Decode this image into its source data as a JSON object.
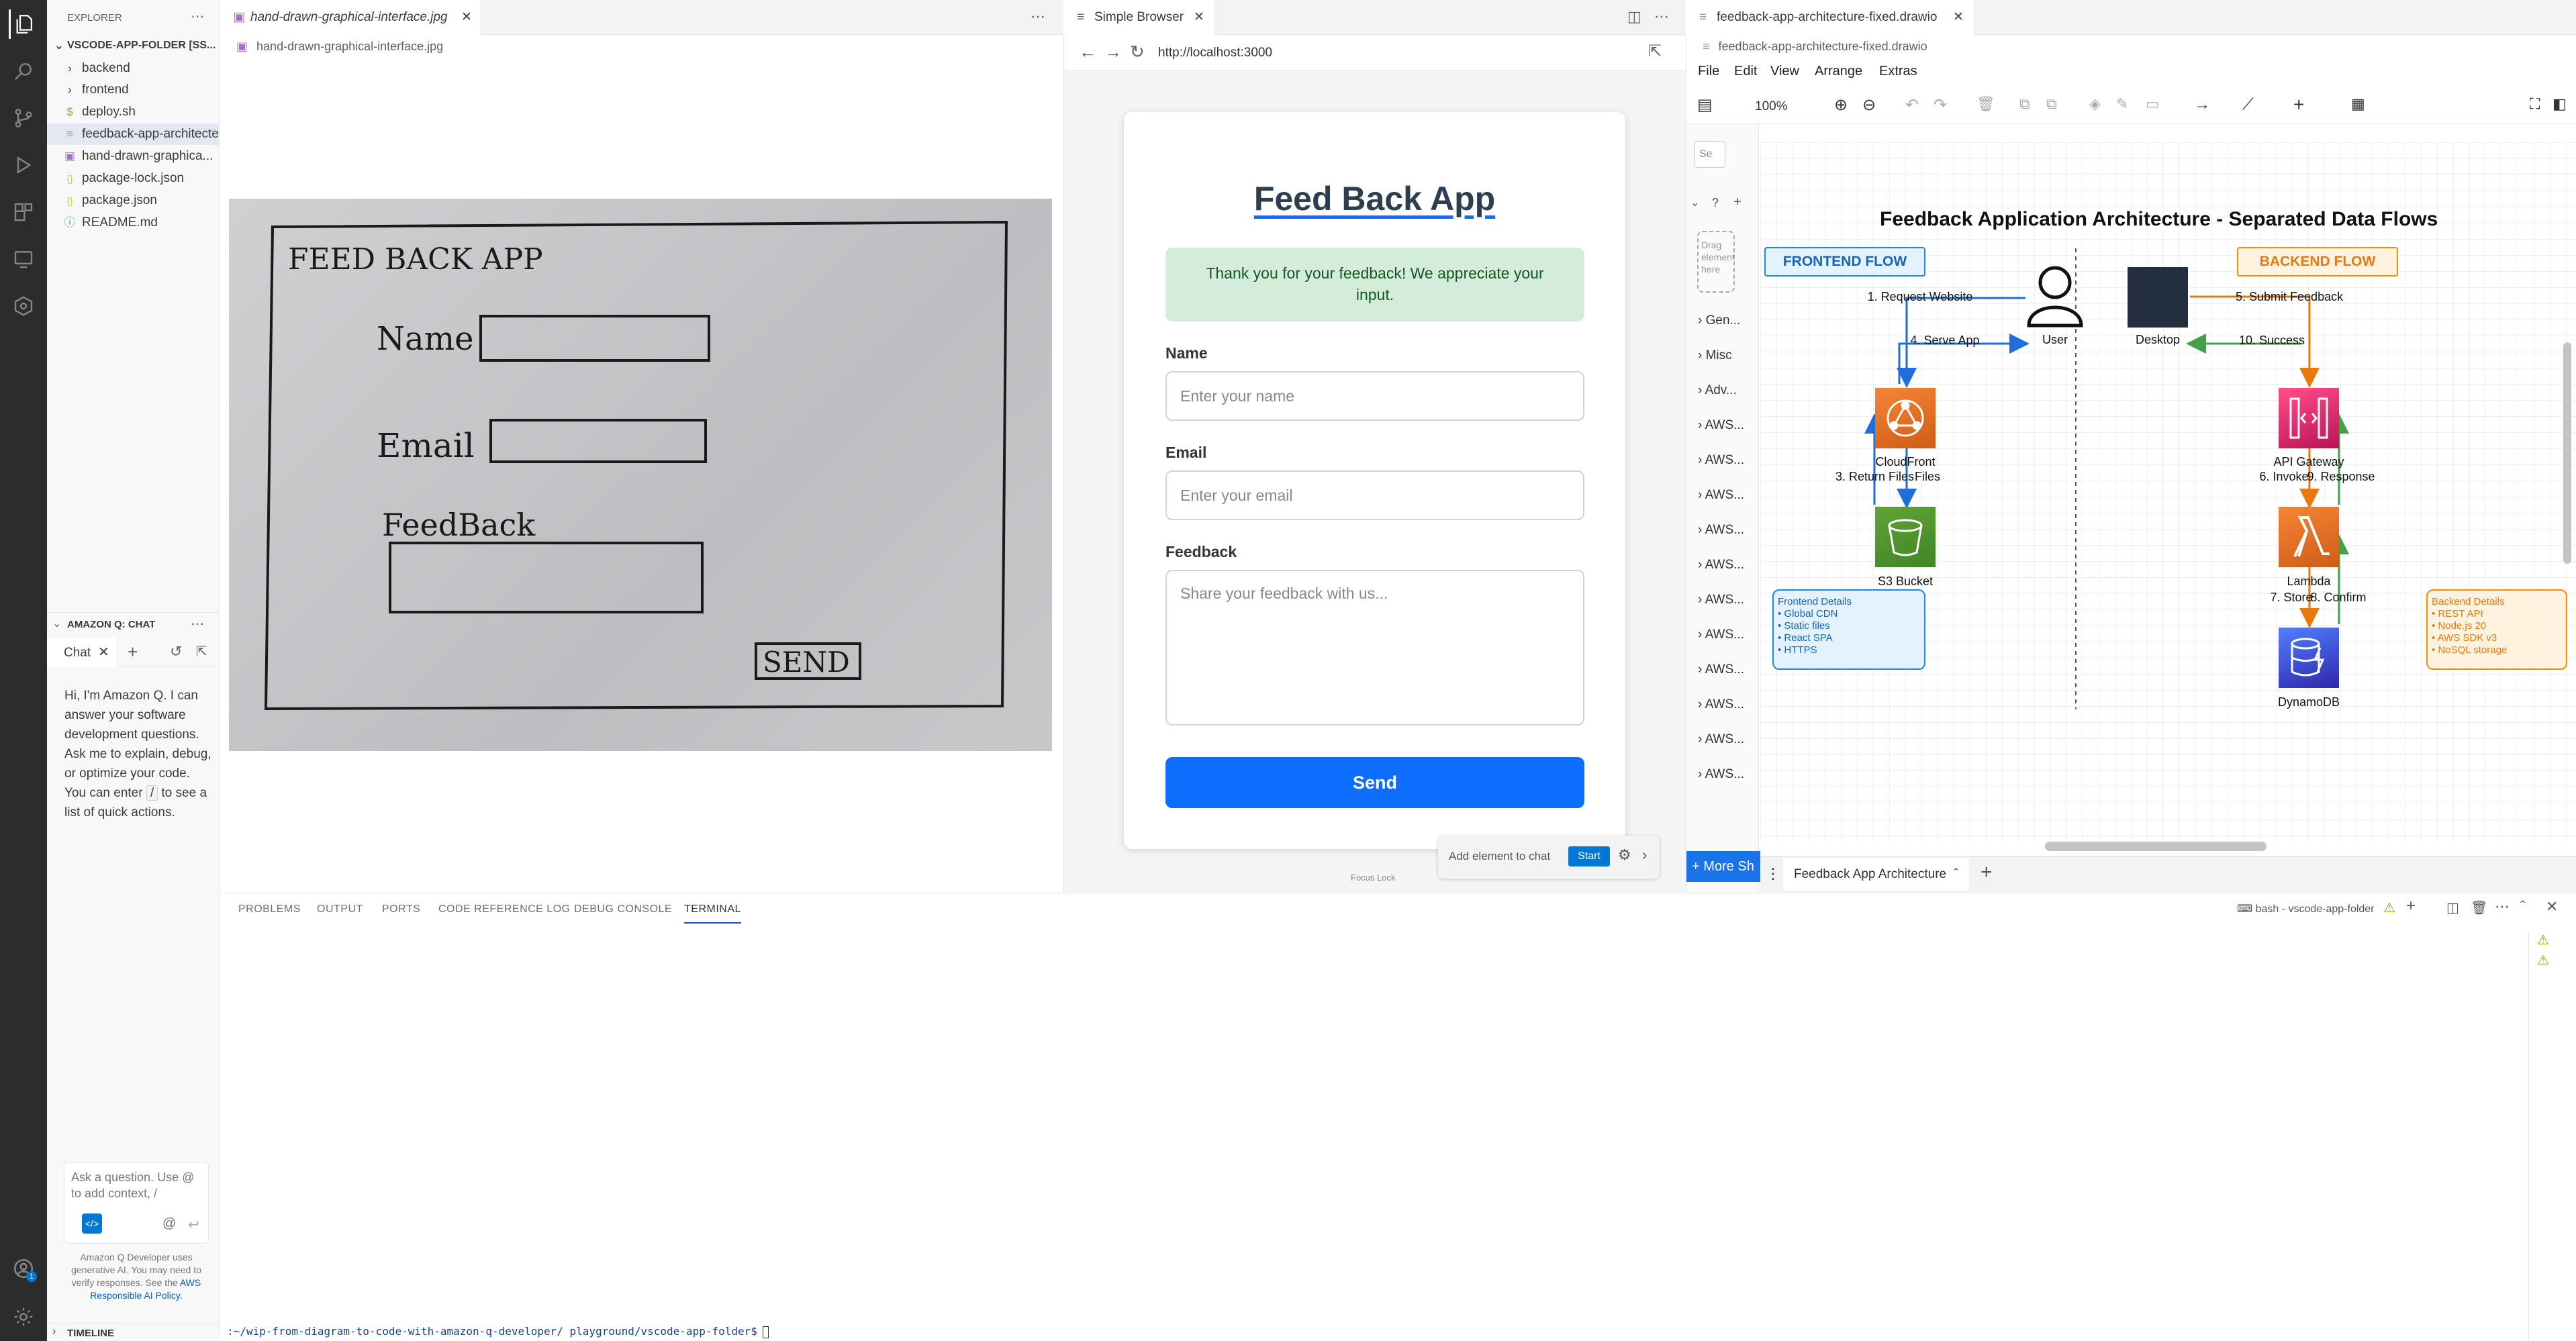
{
  "explorer": {
    "header": "EXPLORER",
    "folder": "VSCODE-APP-FOLDER [SS...",
    "items": [
      {
        "label": "backend",
        "icon": "chevron-right"
      },
      {
        "label": "frontend",
        "icon": "chevron-right"
      },
      {
        "label": "deploy.sh",
        "icon": "$"
      },
      {
        "label": "feedback-app-architecte...",
        "icon": "file"
      },
      {
        "label": "hand-drawn-graphica...",
        "icon": "image"
      },
      {
        "label": "package-lock.json",
        "icon": "{}"
      },
      {
        "label": "package.json",
        "icon": "{}"
      },
      {
        "label": "README.md",
        "icon": "i"
      }
    ]
  },
  "chat": {
    "section_title": "AMAZON Q: CHAT",
    "tab_label": "Chat",
    "intro_lines": [
      "Hi, I'm Amazon Q. I can answer your software development questions.",
      "Ask me to explain, debug, or optimize your code.",
      "You can enter",
      "to see a list of quick actions."
    ],
    "slash": "/",
    "input_placeholder": "Ask a question. Use @ to add context, /",
    "disclaimer": "Amazon Q Developer uses generative AI. You may need to verify responses. See the",
    "policy_link": "AWS Responsible AI Policy."
  },
  "timeline": {
    "label": "TIMELINE"
  },
  "image_editor": {
    "tab": "hand-drawn-graphical-interface.jpg",
    "breadcrumb": "hand-drawn-graphical-interface.jpg",
    "sketch": {
      "title": "FEED BACK APP",
      "name": "Name",
      "email": "Email",
      "feedback": "FeedBack",
      "send": "SEND"
    }
  },
  "browser": {
    "tab": "Simple Browser",
    "url": "http://localhost:3000",
    "app_title": "Feed Back App",
    "success": "Thank you for your feedback! We appreciate your input.",
    "fields": [
      {
        "label": "Name",
        "placeholder": "Enter your name"
      },
      {
        "label": "Email",
        "placeholder": "Enter your email"
      },
      {
        "label": "Feedback",
        "placeholder": "Share your feedback with us..."
      }
    ],
    "send_label": "Send",
    "add_element": "Add element to chat",
    "start_label": "Start",
    "status": "Focus  Lock"
  },
  "drawio": {
    "tab": "feedback-app-architecture-fixed.drawio",
    "breadcrumb": "feedback-app-architecture-fixed.drawio",
    "menus": [
      "File",
      "Edit",
      "View",
      "Arrange",
      "Extras"
    ],
    "zoom": "100%",
    "search_placeholder": "Se",
    "drag_hint": "Drag elements here",
    "shape_groups": [
      "Gen...",
      "Misc",
      "Adv...",
      "AWS...",
      "AWS...",
      "AWS...",
      "AWS...",
      "AWS...",
      "AWS...",
      "AWS...",
      "AWS...",
      "AWS...",
      "AWS...",
      "AWS..."
    ],
    "more_shapes": "+ More Sh",
    "page_tab": "Feedback App Architecture",
    "diagram": {
      "title": "Feedback Application Architecture - Separated Data Flows",
      "frontend_flow": "FRONTEND FLOW",
      "backend_flow": "BACKEND FLOW",
      "user": "User",
      "desktop": "Desktop",
      "e1": "1. Request Website",
      "e4": "4. Serve App",
      "e5": "5. Submit Feedback",
      "e10": "10. Success",
      "cloudfront": "CloudFront",
      "e3": "3. Return Files",
      "e2": "Files",
      "s3": "S3 Bucket",
      "apigw": "API Gateway",
      "e6": "6. Invoke",
      "e9": "9. Response",
      "lambda": "Lambda",
      "e7": "7. Store",
      "e8": "8. Confirm",
      "dynamodb": "DynamoDB",
      "frontend_details": [
        "Frontend Details",
        "• Global CDN",
        "• Static files",
        "• React SPA",
        "• HTTPS"
      ],
      "backend_details": [
        "Backend Details",
        "• REST API",
        "• Node.js 20",
        "• AWS SDK v3",
        "• NoSQL storage"
      ]
    }
  },
  "panel": {
    "tabs": [
      "PROBLEMS",
      "OUTPUT",
      "PORTS",
      "CODE REFERENCE LOG",
      "DEBUG CONSOLE",
      "TERMINAL"
    ],
    "terminal_name": "bash - vscode-app-folder",
    "prompt": ":~/wip-from-diagram-to-code-with-amazon-q-developer/ playground/vscode-app-folder$"
  },
  "colors": {
    "accent": "#0d6efd",
    "success_bg": "#d4edda",
    "success_text": "#155724",
    "frontend_blue": "#1565c0",
    "backend_orange": "#e8790c"
  }
}
